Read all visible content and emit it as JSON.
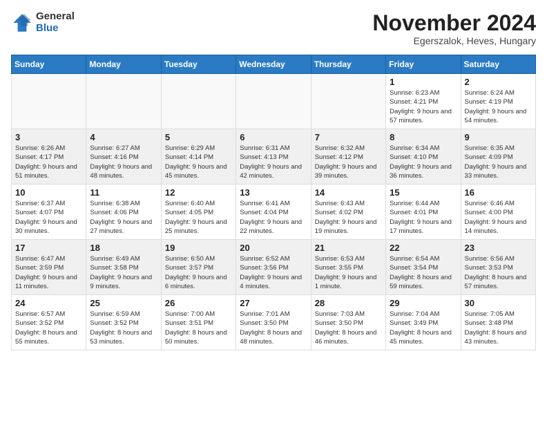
{
  "header": {
    "logo_general": "General",
    "logo_blue": "Blue",
    "month_title": "November 2024",
    "location": "Egerszalok, Heves, Hungary"
  },
  "days_of_week": [
    "Sunday",
    "Monday",
    "Tuesday",
    "Wednesday",
    "Thursday",
    "Friday",
    "Saturday"
  ],
  "weeks": [
    [
      {
        "day": "",
        "info": ""
      },
      {
        "day": "",
        "info": ""
      },
      {
        "day": "",
        "info": ""
      },
      {
        "day": "",
        "info": ""
      },
      {
        "day": "",
        "info": ""
      },
      {
        "day": "1",
        "info": "Sunrise: 6:23 AM\nSunset: 4:21 PM\nDaylight: 9 hours\nand 57 minutes."
      },
      {
        "day": "2",
        "info": "Sunrise: 6:24 AM\nSunset: 4:19 PM\nDaylight: 9 hours\nand 54 minutes."
      }
    ],
    [
      {
        "day": "3",
        "info": "Sunrise: 6:26 AM\nSunset: 4:17 PM\nDaylight: 9 hours\nand 51 minutes."
      },
      {
        "day": "4",
        "info": "Sunrise: 6:27 AM\nSunset: 4:16 PM\nDaylight: 9 hours\nand 48 minutes."
      },
      {
        "day": "5",
        "info": "Sunrise: 6:29 AM\nSunset: 4:14 PM\nDaylight: 9 hours\nand 45 minutes."
      },
      {
        "day": "6",
        "info": "Sunrise: 6:31 AM\nSunset: 4:13 PM\nDaylight: 9 hours\nand 42 minutes."
      },
      {
        "day": "7",
        "info": "Sunrise: 6:32 AM\nSunset: 4:12 PM\nDaylight: 9 hours\nand 39 minutes."
      },
      {
        "day": "8",
        "info": "Sunrise: 6:34 AM\nSunset: 4:10 PM\nDaylight: 9 hours\nand 36 minutes."
      },
      {
        "day": "9",
        "info": "Sunrise: 6:35 AM\nSunset: 4:09 PM\nDaylight: 9 hours\nand 33 minutes."
      }
    ],
    [
      {
        "day": "10",
        "info": "Sunrise: 6:37 AM\nSunset: 4:07 PM\nDaylight: 9 hours\nand 30 minutes."
      },
      {
        "day": "11",
        "info": "Sunrise: 6:38 AM\nSunset: 4:06 PM\nDaylight: 9 hours\nand 27 minutes."
      },
      {
        "day": "12",
        "info": "Sunrise: 6:40 AM\nSunset: 4:05 PM\nDaylight: 9 hours\nand 25 minutes."
      },
      {
        "day": "13",
        "info": "Sunrise: 6:41 AM\nSunset: 4:04 PM\nDaylight: 9 hours\nand 22 minutes."
      },
      {
        "day": "14",
        "info": "Sunrise: 6:43 AM\nSunset: 4:02 PM\nDaylight: 9 hours\nand 19 minutes."
      },
      {
        "day": "15",
        "info": "Sunrise: 6:44 AM\nSunset: 4:01 PM\nDaylight: 9 hours\nand 17 minutes."
      },
      {
        "day": "16",
        "info": "Sunrise: 6:46 AM\nSunset: 4:00 PM\nDaylight: 9 hours\nand 14 minutes."
      }
    ],
    [
      {
        "day": "17",
        "info": "Sunrise: 6:47 AM\nSunset: 3:59 PM\nDaylight: 9 hours\nand 11 minutes."
      },
      {
        "day": "18",
        "info": "Sunrise: 6:49 AM\nSunset: 3:58 PM\nDaylight: 9 hours\nand 9 minutes."
      },
      {
        "day": "19",
        "info": "Sunrise: 6:50 AM\nSunset: 3:57 PM\nDaylight: 9 hours\nand 6 minutes."
      },
      {
        "day": "20",
        "info": "Sunrise: 6:52 AM\nSunset: 3:56 PM\nDaylight: 9 hours\nand 4 minutes."
      },
      {
        "day": "21",
        "info": "Sunrise: 6:53 AM\nSunset: 3:55 PM\nDaylight: 9 hours\nand 1 minute."
      },
      {
        "day": "22",
        "info": "Sunrise: 6:54 AM\nSunset: 3:54 PM\nDaylight: 8 hours\nand 59 minutes."
      },
      {
        "day": "23",
        "info": "Sunrise: 6:56 AM\nSunset: 3:53 PM\nDaylight: 8 hours\nand 57 minutes."
      }
    ],
    [
      {
        "day": "24",
        "info": "Sunrise: 6:57 AM\nSunset: 3:52 PM\nDaylight: 8 hours\nand 55 minutes."
      },
      {
        "day": "25",
        "info": "Sunrise: 6:59 AM\nSunset: 3:52 PM\nDaylight: 8 hours\nand 53 minutes."
      },
      {
        "day": "26",
        "info": "Sunrise: 7:00 AM\nSunset: 3:51 PM\nDaylight: 8 hours\nand 50 minutes."
      },
      {
        "day": "27",
        "info": "Sunrise: 7:01 AM\nSunset: 3:50 PM\nDaylight: 8 hours\nand 48 minutes."
      },
      {
        "day": "28",
        "info": "Sunrise: 7:03 AM\nSunset: 3:50 PM\nDaylight: 8 hours\nand 46 minutes."
      },
      {
        "day": "29",
        "info": "Sunrise: 7:04 AM\nSunset: 3:49 PM\nDaylight: 8 hours\nand 45 minutes."
      },
      {
        "day": "30",
        "info": "Sunrise: 7:05 AM\nSunset: 3:48 PM\nDaylight: 8 hours\nand 43 minutes."
      }
    ]
  ]
}
